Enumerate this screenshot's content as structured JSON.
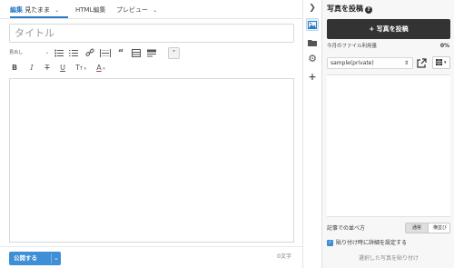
{
  "editor": {
    "tabs": [
      {
        "mode": "編集",
        "label": "見たまま"
      },
      {
        "label": "HTML編集"
      },
      {
        "label": "プレビュー"
      }
    ],
    "title_placeholder": "タイトル",
    "toolbar": {
      "heading_select": "見出し",
      "row1_icons": [
        "bulleted-list-icon",
        "numbered-list-icon",
        "link-icon",
        "horizontal-line-icon",
        "quote-icon",
        "table-icon",
        "more-icon"
      ],
      "row2": {
        "bold": "B",
        "italic": "I",
        "strikethrough": "T",
        "underline": "U",
        "font_size": "T",
        "font_color": "A"
      }
    },
    "publish": {
      "label": "公開する"
    },
    "word_count": "0文字"
  },
  "panel": {
    "title": "写真を投稿",
    "post_button": "+ 写真を投稿",
    "quota_label": "今月のファイル利用量",
    "quota_value": "0%",
    "album_select": "sample(private)",
    "sort_label": "記事での並べ方",
    "sort_options": [
      "通常",
      "横並び"
    ],
    "paste_detail_label": "貼り付け時に詳細を設定する",
    "paste_button": "選択した写真を貼り付け"
  },
  "colors": {
    "accent": "#3e8fd6",
    "dark_button": "#333333",
    "panel_bg": "#f7f7f7"
  }
}
